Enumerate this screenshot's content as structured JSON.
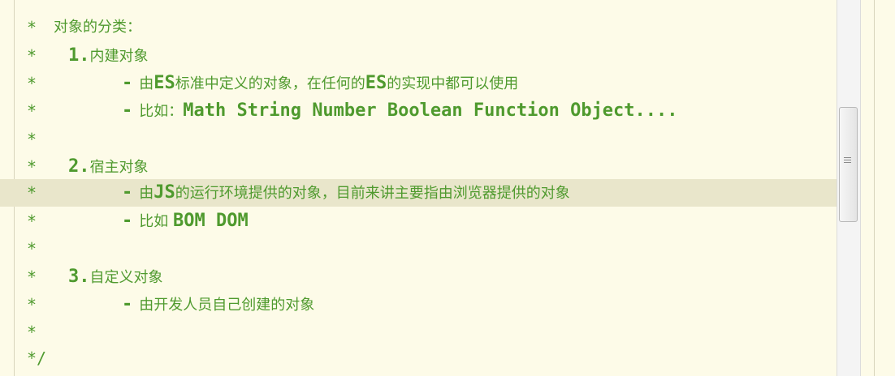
{
  "comment_marker": "*",
  "comment_end": "*/",
  "lines": {
    "l1": "对象的分类：",
    "l2_num": "1.",
    "l2_text": "内建对象",
    "l3_dash": "-",
    "l3_a": "由",
    "l3_b": "ES",
    "l3_c": "标准中定义的对象，在任何的",
    "l3_d": "ES",
    "l3_e": "的实现中都可以使用",
    "l4_dash": "-",
    "l4_a": "比如：",
    "l4_b": "Math String Number Boolean Function Object....",
    "l6_num": "2.",
    "l6_text": "宿主对象",
    "l7_dash": "-",
    "l7_a": "由",
    "l7_b": "JS",
    "l7_c": "的运行环境提供的对象，目前来讲主要指由浏览器提供的对象",
    "l8_dash": "-",
    "l8_a": "比如 ",
    "l8_b": "BOM DOM",
    "l10_num": "3.",
    "l10_text": "自定义对象",
    "l11_dash": "-",
    "l11_a": "由开发人员自己创建的对象"
  },
  "colors": {
    "comment": "#4f9a2e",
    "background": "#fdfbe8",
    "current_line": "#e9e6cb"
  }
}
